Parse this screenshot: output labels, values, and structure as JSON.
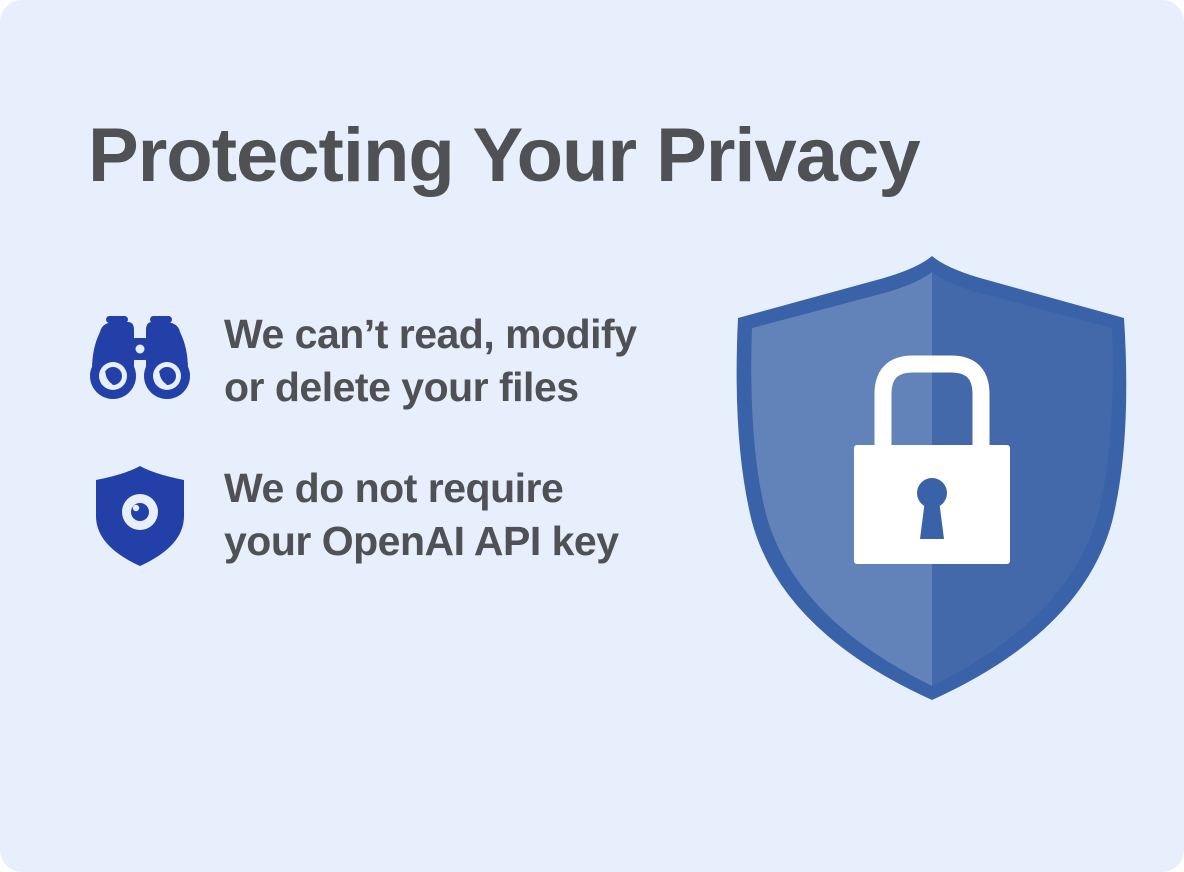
{
  "heading": {
    "title": "Protecting Your Privacy"
  },
  "features": [
    {
      "icon": "binoculars-icon",
      "line1": "We can’t read, modify",
      "line2": "or delete your files"
    },
    {
      "icon": "shield-eye-icon",
      "line1": "We do not require",
      "line2": "your OpenAI API key"
    }
  ],
  "illustration": {
    "icon": "shield-lock-icon"
  },
  "colors": {
    "background": "#e7effc",
    "text": "#4f5154",
    "icon_blue": "#2240a8",
    "shield_outer": "#3a62a8",
    "shield_left": "#6283b9",
    "shield_right": "#4369aa",
    "lock": "#ffffff"
  }
}
